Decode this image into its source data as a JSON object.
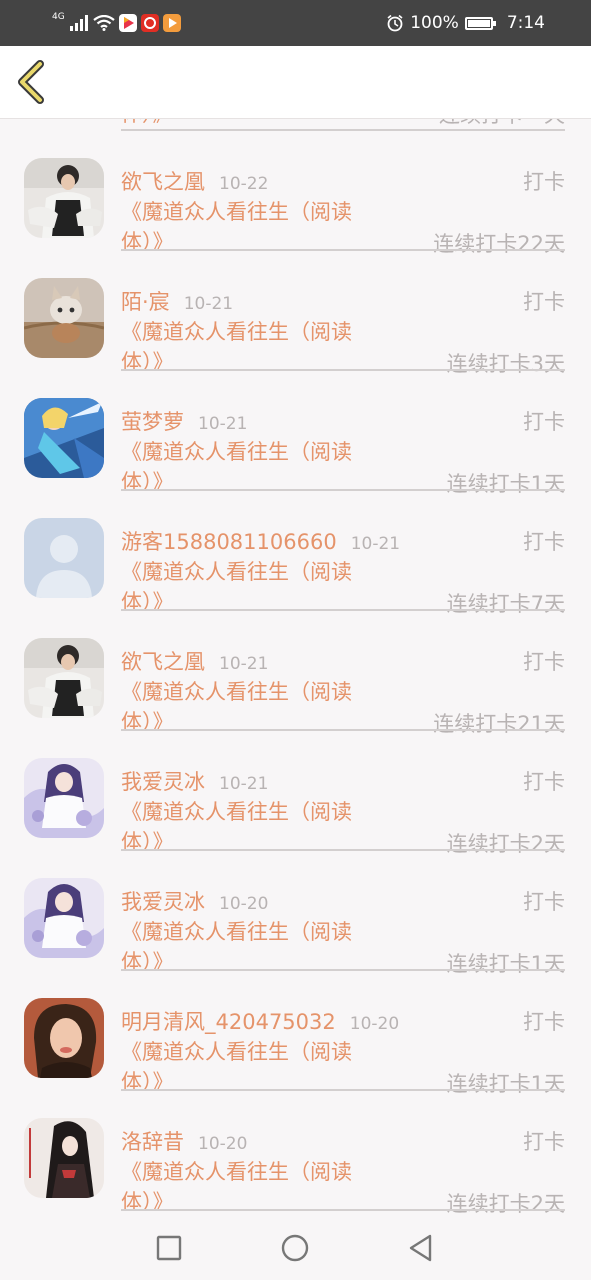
{
  "status_bar": {
    "network": "4G",
    "battery": "100%",
    "time": "7:14",
    "battery_level": 1.0,
    "icons": [
      "signal-icon",
      "wifi-icon",
      "video-app-icon",
      "shopping-app-icon",
      "player-app-icon",
      "alarm-icon",
      "battery-icon"
    ]
  },
  "header": {
    "back_icon": "chevron-left-icon",
    "accent": "#e9d86b"
  },
  "colors": {
    "name": "#e5936a",
    "muted": "#b8b3b3",
    "divider": "#d3cfcf"
  },
  "partial_top": {
    "title_tail": "体）》",
    "streak": "连续打卡**天"
  },
  "list": [
    {
      "name": "欲飞之凰",
      "date": "10-22",
      "action": "打卡",
      "title": "《魔道众人看往生（阅读体）》",
      "streak": "连续打卡22天",
      "avatar": "photo-man-sitting"
    },
    {
      "name": "陌·宸",
      "date": "10-21",
      "action": "打卡",
      "title": "《魔道众人看往生（阅读体）》",
      "streak": "连续打卡3天",
      "avatar": "photo-cat"
    },
    {
      "name": "萤梦萝",
      "date": "10-21",
      "action": "打卡",
      "title": "《魔道众人看往生（阅读体）》",
      "streak": "连续打卡1天",
      "avatar": "anime-blue-warrior"
    },
    {
      "name": "游客1588081106660",
      "date": "10-21",
      "action": "打卡",
      "title": "《魔道众人看往生（阅读体）》",
      "streak": "连续打卡7天",
      "avatar": "default-user"
    },
    {
      "name": "欲飞之凰",
      "date": "10-21",
      "action": "打卡",
      "title": "《魔道众人看往生（阅读体）》",
      "streak": "连续打卡21天",
      "avatar": "photo-man-sitting"
    },
    {
      "name": "我爱灵冰",
      "date": "10-21",
      "action": "打卡",
      "title": "《魔道众人看往生（阅读体）》",
      "streak": "连续打卡2天",
      "avatar": "anime-purple-girl"
    },
    {
      "name": "我爱灵冰",
      "date": "10-20",
      "action": "打卡",
      "title": "《魔道众人看往生（阅读体）》",
      "streak": "连续打卡1天",
      "avatar": "anime-purple-girl"
    },
    {
      "name": "明月清风_420475032",
      "date": "10-20",
      "action": "打卡",
      "title": "《魔道众人看往生（阅读体）》",
      "streak": "连续打卡1天",
      "avatar": "photo-woman"
    },
    {
      "name": "洛辞昔",
      "date": "10-20",
      "action": "打卡",
      "title": "《魔道众人看往生（阅读体）》",
      "streak": "连续打卡2天",
      "avatar": "anime-dark-hair"
    }
  ],
  "nav": {
    "buttons": [
      "recent-apps-icon",
      "home-icon",
      "back-icon"
    ]
  }
}
